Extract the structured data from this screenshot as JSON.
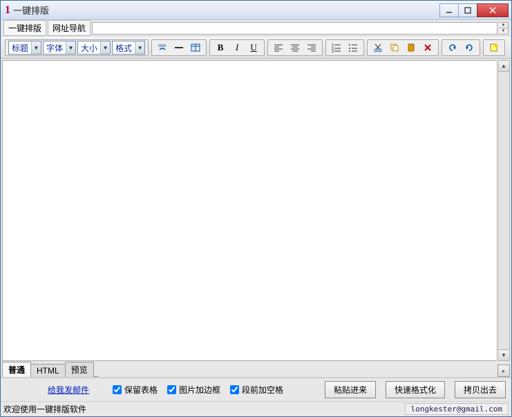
{
  "titlebar": {
    "app_number": "1",
    "title": "一键排版"
  },
  "menubar": {
    "format_label": "一键排版",
    "nav_label": "网址导航"
  },
  "toolbar": {
    "heading": "标题",
    "font": "字体",
    "size": "大小",
    "format": "格式"
  },
  "tabs": {
    "normal": "普通",
    "html": "HTML",
    "preview": "预览"
  },
  "bottom": {
    "email": "给我发邮件",
    "keep_table": "保留表格",
    "img_border": "图片加边框",
    "para_space": "段前加空格",
    "paste_in": "粘贴进来",
    "quick_fmt": "快速格式化",
    "copy_out": "拷贝出去"
  },
  "status": {
    "welcome": "欢迎使用一键排版软件",
    "email": "longkester@gmail.com"
  }
}
